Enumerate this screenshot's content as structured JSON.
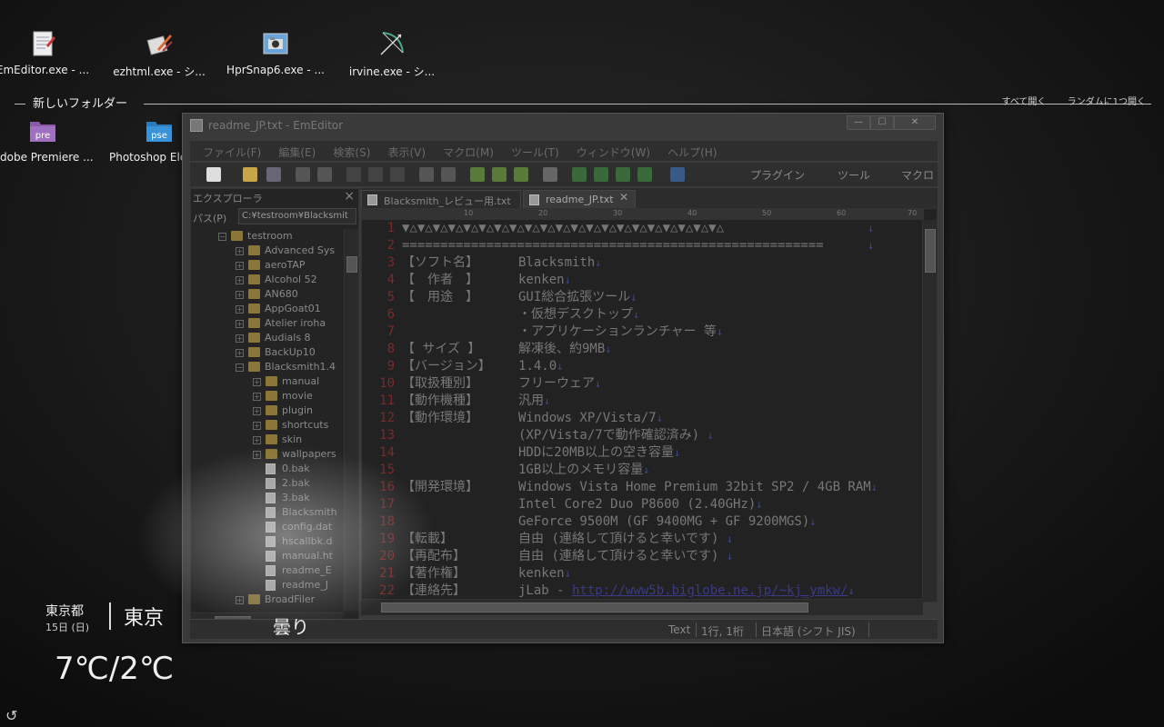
{
  "desktop_icons": [
    {
      "label": "EmEditor.exe - ...",
      "icon": "notepad-icon"
    },
    {
      "label": "ezhtml.exe - シ...",
      "icon": "ezhtml-icon"
    },
    {
      "label": "HprSnap6.exe - ...",
      "icon": "camera-icon"
    },
    {
      "label": "irvine.exe - シ...",
      "icon": "bow-arrow-icon"
    }
  ],
  "folder_group": {
    "title": "新しいフォルダー",
    "links": [
      "すべて開く",
      "ランダムに1つ開く"
    ],
    "icons": [
      {
        "label": "Adobe Premiere ...",
        "icon_text": "pre",
        "icon": "premiere-icon"
      },
      {
        "label": "Photoshop Eleme...",
        "icon_text": "pse",
        "icon": "photoshop-icon"
      }
    ]
  },
  "weather": {
    "region": "東京都",
    "date": "15日 (日)",
    "city": "東京",
    "condition": "曇り",
    "temps": "7℃/2℃"
  },
  "window": {
    "title": "readme_JP.txt - EmEditor",
    "controls": [
      "—",
      "☐",
      "✕"
    ],
    "menu": [
      "ファイル(F)",
      "編集(E)",
      "検索(S)",
      "表示(V)",
      "マクロ(M)",
      "ツール(T)",
      "ウィンドウ(W)",
      "ヘルプ(H)"
    ],
    "toolbar_sections": [
      "プラグイン",
      "ツール",
      "マクロ"
    ],
    "explorer": {
      "title": "エクスプローラ",
      "path_label": "パス(P)",
      "path_value": "C:¥testroom¥Blacksmit",
      "tree": [
        {
          "label": "testroom",
          "level": 0,
          "type": "folder",
          "toggle": "−"
        },
        {
          "label": "Advanced Sys",
          "level": 1,
          "type": "folder",
          "toggle": "+"
        },
        {
          "label": "aeroTAP",
          "level": 1,
          "type": "folder",
          "toggle": "+"
        },
        {
          "label": "Alcohol 52",
          "level": 1,
          "type": "folder",
          "toggle": "+"
        },
        {
          "label": "AN680",
          "level": 1,
          "type": "folder",
          "toggle": "+"
        },
        {
          "label": "AppGoat01",
          "level": 1,
          "type": "folder",
          "toggle": "+"
        },
        {
          "label": "Atelier iroha",
          "level": 1,
          "type": "folder",
          "toggle": "+"
        },
        {
          "label": "Audials 8",
          "level": 1,
          "type": "folder",
          "toggle": "+"
        },
        {
          "label": "BackUp10",
          "level": 1,
          "type": "folder",
          "toggle": "+"
        },
        {
          "label": "Blacksmith1.4",
          "level": 1,
          "type": "folder",
          "toggle": "−"
        },
        {
          "label": "manual",
          "level": 2,
          "type": "folder",
          "toggle": "+"
        },
        {
          "label": "movie",
          "level": 2,
          "type": "folder",
          "toggle": "+"
        },
        {
          "label": "plugin",
          "level": 2,
          "type": "folder",
          "toggle": "+"
        },
        {
          "label": "shortcuts",
          "level": 2,
          "type": "folder",
          "toggle": "+"
        },
        {
          "label": "skin",
          "level": 2,
          "type": "folder",
          "toggle": "+"
        },
        {
          "label": "wallpapers",
          "level": 2,
          "type": "folder",
          "toggle": "+"
        },
        {
          "label": "0.bak",
          "level": 2,
          "type": "file",
          "toggle": ""
        },
        {
          "label": "2.bak",
          "level": 2,
          "type": "file",
          "toggle": ""
        },
        {
          "label": "3.bak",
          "level": 2,
          "type": "file",
          "toggle": ""
        },
        {
          "label": "Blacksmith",
          "level": 2,
          "type": "file",
          "toggle": ""
        },
        {
          "label": "config.dat",
          "level": 2,
          "type": "file",
          "toggle": ""
        },
        {
          "label": "hscallbk.d",
          "level": 2,
          "type": "file",
          "toggle": ""
        },
        {
          "label": "manual.ht",
          "level": 2,
          "type": "file",
          "toggle": ""
        },
        {
          "label": "readme_E",
          "level": 2,
          "type": "file",
          "toggle": ""
        },
        {
          "label": "readme_J",
          "level": 2,
          "type": "file",
          "toggle": ""
        },
        {
          "label": "BroadFiler",
          "level": 1,
          "type": "folder",
          "toggle": "+"
        }
      ]
    },
    "tabs": [
      {
        "label": "Blacksmith_レビュー用.txt",
        "active": false
      },
      {
        "label": "readme_JP.txt",
        "active": true
      }
    ],
    "ruler_marks": [
      "10",
      "20",
      "30",
      "40",
      "50",
      "60",
      "70"
    ],
    "editor_lines": [
      {
        "n": "1",
        "key": "▼△▼△▼△▼△▼△▼△▼△▼△▼△▼△▼△▼△▼△▼△▼△▼△▼△▼△▼△▼△▼△",
        "val": "",
        "link": ""
      },
      {
        "n": "2",
        "key": "=======================================================",
        "val": "",
        "link": ""
      },
      {
        "n": "3",
        "key": "【ソフト名】",
        "val": "Blacksmith",
        "link": ""
      },
      {
        "n": "4",
        "key": "【　作者　】",
        "val": "kenken",
        "link": ""
      },
      {
        "n": "5",
        "key": "【　用途　】",
        "val": "GUI総合拡張ツール",
        "link": ""
      },
      {
        "n": "6",
        "key": "",
        "val": "・仮想デスクトップ",
        "link": ""
      },
      {
        "n": "7",
        "key": "",
        "val": "・アプリケーションランチャー 等",
        "link": ""
      },
      {
        "n": "8",
        "key": "【 サイズ 】",
        "val": "解凍後、約9MB",
        "link": ""
      },
      {
        "n": "9",
        "key": "【バージョン】",
        "val": "1.4.0",
        "link": ""
      },
      {
        "n": "10",
        "key": "【取扱種別】",
        "val": "フリーウェア",
        "link": ""
      },
      {
        "n": "11",
        "key": "【動作機種】",
        "val": "汎用",
        "link": ""
      },
      {
        "n": "12",
        "key": "【動作環境】",
        "val": "Windows XP/Vista/7",
        "link": ""
      },
      {
        "n": "13",
        "key": "",
        "val": " (XP/Vista/7で動作確認済み) ",
        "link": ""
      },
      {
        "n": "14",
        "key": "",
        "val": "HDDに20MB以上の空き容量",
        "link": ""
      },
      {
        "n": "15",
        "key": "",
        "val": "1GB以上のメモリ容量",
        "link": ""
      },
      {
        "n": "16",
        "key": "【開発環境】",
        "val": "Windows Vista Home Premium 32bit SP2 / 4GB RAM",
        "link": ""
      },
      {
        "n": "17",
        "key": "",
        "val": "Intel Core2 Duo P8600 (2.40GHz)",
        "link": ""
      },
      {
        "n": "18",
        "key": "",
        "val": "GeForce 9500M (GF 9400MG + GF 9200MGS)",
        "link": ""
      },
      {
        "n": "19",
        "key": "【転載】",
        "val": "自由 (連絡して頂けると幸いです) ",
        "link": ""
      },
      {
        "n": "20",
        "key": "【再配布】",
        "val": "自由 (連絡して頂けると幸いです) ",
        "link": ""
      },
      {
        "n": "21",
        "key": "【著作権】",
        "val": "kenken",
        "link": ""
      },
      {
        "n": "22",
        "key": "【連絡先】",
        "val": "jLab - ",
        "link": "http://www5b.biglobe.ne.jp/~kj_ymkw/"
      }
    ],
    "newline_mark": "↓",
    "status": {
      "mode": "Text",
      "position": "1行, 1桁",
      "encoding": "日本語 (シフト JIS)"
    }
  },
  "refresh_symbol": "↺"
}
